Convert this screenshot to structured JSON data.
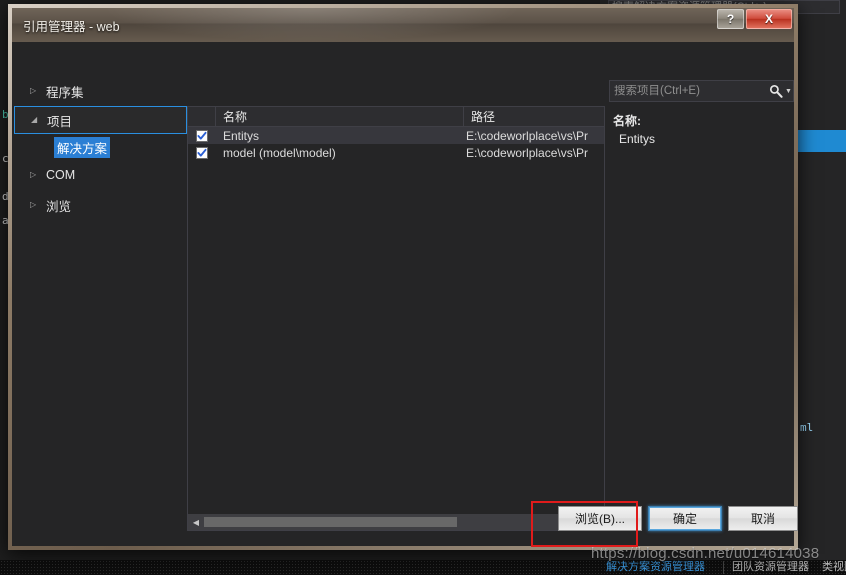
{
  "window": {
    "title": "引用管理器 - web",
    "help_button": "?",
    "close_button": "X"
  },
  "search": {
    "placeholder": "搜索项目(Ctrl+E)",
    "value": "",
    "icon": "search-icon",
    "caret_icon": "chevron-down-icon"
  },
  "tree": {
    "nodes": [
      {
        "label": "程序集",
        "expanded": false,
        "arrow": "▷",
        "selected": false,
        "focused": false
      },
      {
        "label": "项目",
        "expanded": true,
        "arrow": "◢",
        "selected": false,
        "focused": true
      },
      {
        "label": "解决方案",
        "expanded": false,
        "arrow": "",
        "selected": true,
        "focused": false,
        "child": true
      },
      {
        "label": "COM",
        "expanded": false,
        "arrow": "▷",
        "selected": false,
        "focused": false
      },
      {
        "label": "浏览",
        "expanded": false,
        "arrow": "▷",
        "selected": false,
        "focused": false
      }
    ]
  },
  "listview": {
    "columns": [
      "",
      "名称",
      "路径"
    ],
    "rows": [
      {
        "checked": true,
        "name": "Entitys",
        "path": "E:\\codeworlplace\\vs\\Pr",
        "selected": true
      },
      {
        "checked": true,
        "name": "model (model\\model)",
        "path": "E:\\codeworlplace\\vs\\Pr",
        "selected": false
      }
    ],
    "scroll_left_arrow": "◀",
    "scroll_right_arrow": "▶"
  },
  "detail": {
    "label": "名称:",
    "value": "Entitys"
  },
  "footer": {
    "browse_label": "浏览(B)...",
    "ok_label": "确定",
    "cancel_label": "取消"
  },
  "annotation": {
    "color": "#e01b1b",
    "target": "浏览(B)..."
  },
  "watermark": {
    "text": "https://blog.csdn.net/u014614038"
  },
  "background": {
    "search_placeholder": "搜索解决方案资源管理器(Ctrl+;)",
    "code_fragments": [
      "b",
      "c",
      "d",
      "a"
    ],
    "text_fragment": "ml",
    "solution_rows": [
      "",
      ""
    ],
    "tabs": [
      {
        "label": "解决方案资源管理器",
        "active": true
      },
      {
        "label": "团队资源管理器",
        "active": false
      },
      {
        "label": "类视图",
        "active": false
      }
    ]
  }
}
